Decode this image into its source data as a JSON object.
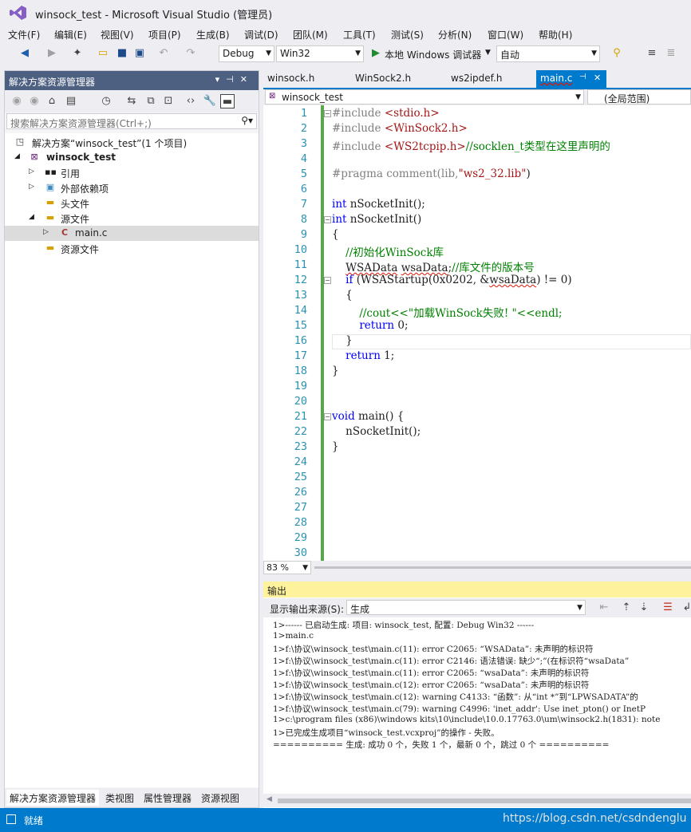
{
  "window": {
    "title": "winsock_test - Microsoft Visual Studio (管理员)"
  },
  "menu": [
    "文件(F)",
    "编辑(E)",
    "视图(V)",
    "项目(P)",
    "生成(B)",
    "调试(D)",
    "团队(M)",
    "工具(T)",
    "测试(S)",
    "分析(N)",
    "窗口(W)",
    "帮助(H)"
  ],
  "toolbar": {
    "config": "Debug",
    "platform": "Win32",
    "run_label": "本地 Windows 调试器",
    "auto": "自动"
  },
  "solution_explorer": {
    "title": "解决方案资源管理器",
    "search_placeholder": "搜索解决方案资源管理器(Ctrl+;)",
    "tree": [
      {
        "label": "解决方案“winsock_test”(1 个项目)"
      },
      {
        "label": "winsock_test"
      },
      {
        "label": "引用"
      },
      {
        "label": "外部依赖项"
      },
      {
        "label": "头文件"
      },
      {
        "label": "源文件"
      },
      {
        "label": "main.c"
      },
      {
        "label": "资源文件"
      }
    ],
    "tabs": [
      "解决方案资源管理器",
      "类视图",
      "属性管理器",
      "资源视图"
    ]
  },
  "editor": {
    "tabs": [
      "winsock.h",
      "WinSock2.h",
      "ws2ipdef.h",
      "main.c"
    ],
    "nav_left": "winsock_test",
    "nav_right": "(全局范围)",
    "zoom": "83 %",
    "line_numbers": [
      "1",
      "2",
      "3",
      "4",
      "5",
      "6",
      "7",
      "8",
      "9",
      "10",
      "11",
      "12",
      "13",
      "14",
      "15",
      "16",
      "17",
      "18",
      "19",
      "20",
      "21",
      "22",
      "23",
      "24",
      "25",
      "26",
      "27",
      "28",
      "29",
      "30"
    ],
    "code": {
      "l1a": "#include ",
      "l1b": "<stdio.h>",
      "l2a": "#include ",
      "l2b": "<WinSock2.h>",
      "l3a": "#include ",
      "l3b": "<WS2tcpip.h>",
      "l3c": "//socklen_t类型在这里声明的",
      "l5a": "#pragma comment(lib,",
      "l5b": "\"ws2_32.lib\"",
      "l5c": ")",
      "l7a": "int",
      "l7b": " nSocketInit();",
      "l8a": "int",
      "l8b": " nSocketInit()",
      "l9": "{",
      "l10": "    //初始化WinSock库",
      "l11a": "    ",
      "l11b": "WSAData",
      "l11c": " ",
      "l11d": "wsaData",
      "l11e": ";",
      "l11f": "//库文件的版本号",
      "l12a": "    ",
      "l12b": "if",
      "l12c": " (WSAStartup(0x0202, &",
      "l12d": "wsaData",
      "l12e": ") != 0)",
      "l13": "    {",
      "l14": "        //cout<<\"加载WinSock失败! \"<<endl;",
      "l15a": "        ",
      "l15b": "return",
      "l15c": " 0;",
      "l16": "    }",
      "l17a": "    ",
      "l17b": "return",
      "l17c": " 1;",
      "l18": "}",
      "l21a": "void",
      "l21b": " main() {",
      "l22": "    nSocketInit();",
      "l23": "}"
    }
  },
  "output": {
    "title": "输出",
    "source_label": "显示输出来源(S):",
    "source_value": "生成",
    "lines": [
      "1>------ 已启动生成: 项目: winsock_test, 配置: Debug Win32 ------",
      "1>main.c",
      "1>f:\\协议\\winsock_test\\main.c(11): error C2065: “WSAData”: 未声明的标识符",
      "1>f:\\协议\\winsock_test\\main.c(11): error C2146: 语法错误: 缺少“;”(在标识符“wsaData”",
      "1>f:\\协议\\winsock_test\\main.c(11): error C2065: “wsaData”: 未声明的标识符",
      "1>f:\\协议\\winsock_test\\main.c(12): error C2065: “wsaData”: 未声明的标识符",
      "1>f:\\协议\\winsock_test\\main.c(12): warning C4133: “函数”: 从“int *”到“LPWSADATA”的",
      "1>f:\\协议\\winsock_test\\main.c(79): warning C4996: 'inet_addr': Use inet_pton() or InetP",
      "1>c:\\program files (x86)\\windows kits\\10\\include\\10.0.17763.0\\um\\winsock2.h(1831): note",
      "1>已完成生成项目“winsock_test.vcxproj”的操作 - 失败。",
      "========== 生成: 成功 0 个，失败 1 个，最新 0 个，跳过 0 个 =========="
    ]
  },
  "status": {
    "text": "就绪",
    "watermark": "https://blog.csdn.net/csdndenglu"
  },
  "colors": {
    "accent": "#007acc",
    "panel_header": "#4d6082",
    "output_header": "#fff29d",
    "linenum": "#2b91af",
    "keyword": "#0000ff",
    "comment": "#008000",
    "string": "#a31515"
  }
}
